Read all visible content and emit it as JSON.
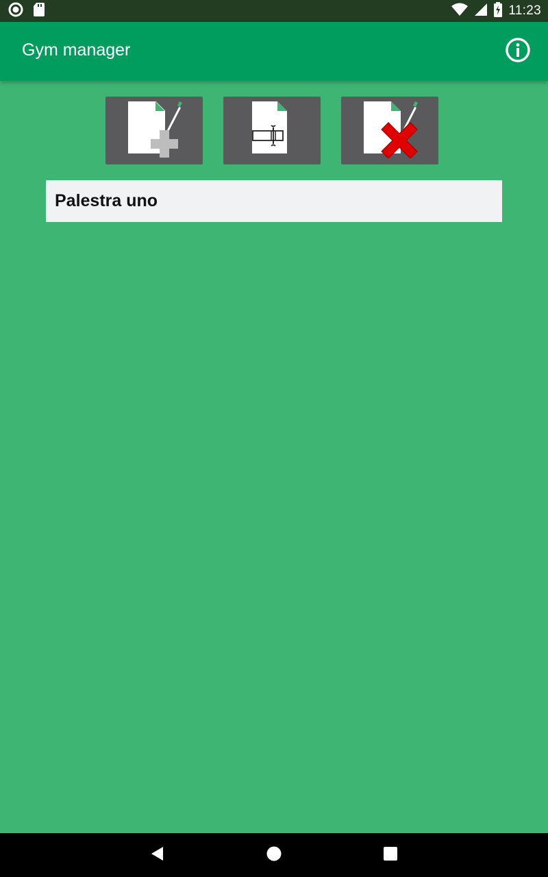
{
  "status_bar": {
    "time": "11:23",
    "left_icons": [
      "circle-status-icon",
      "sd-card-icon"
    ],
    "right_icons": [
      "wifi-icon",
      "signal-icon",
      "battery-charging-icon"
    ]
  },
  "app_bar": {
    "title": "Gym manager",
    "action_icon": "info-icon"
  },
  "toolbar": {
    "buttons": [
      {
        "name": "add-gym-button",
        "icon": "document-add-icon"
      },
      {
        "name": "rename-gym-button",
        "icon": "document-rename-icon"
      },
      {
        "name": "delete-gym-button",
        "icon": "document-delete-icon"
      }
    ]
  },
  "gyms": {
    "items": [
      {
        "label": "Palestra uno"
      }
    ]
  },
  "nav_bar": {
    "icons": [
      "back-icon",
      "home-icon",
      "recents-icon"
    ]
  },
  "colors": {
    "background": "#3eb573",
    "app_bar": "#009d5f",
    "status_bar": "#233d22",
    "tool_button": "#5a5a5c",
    "list_item": "#f1f2f4",
    "delete_red": "#e00000"
  }
}
